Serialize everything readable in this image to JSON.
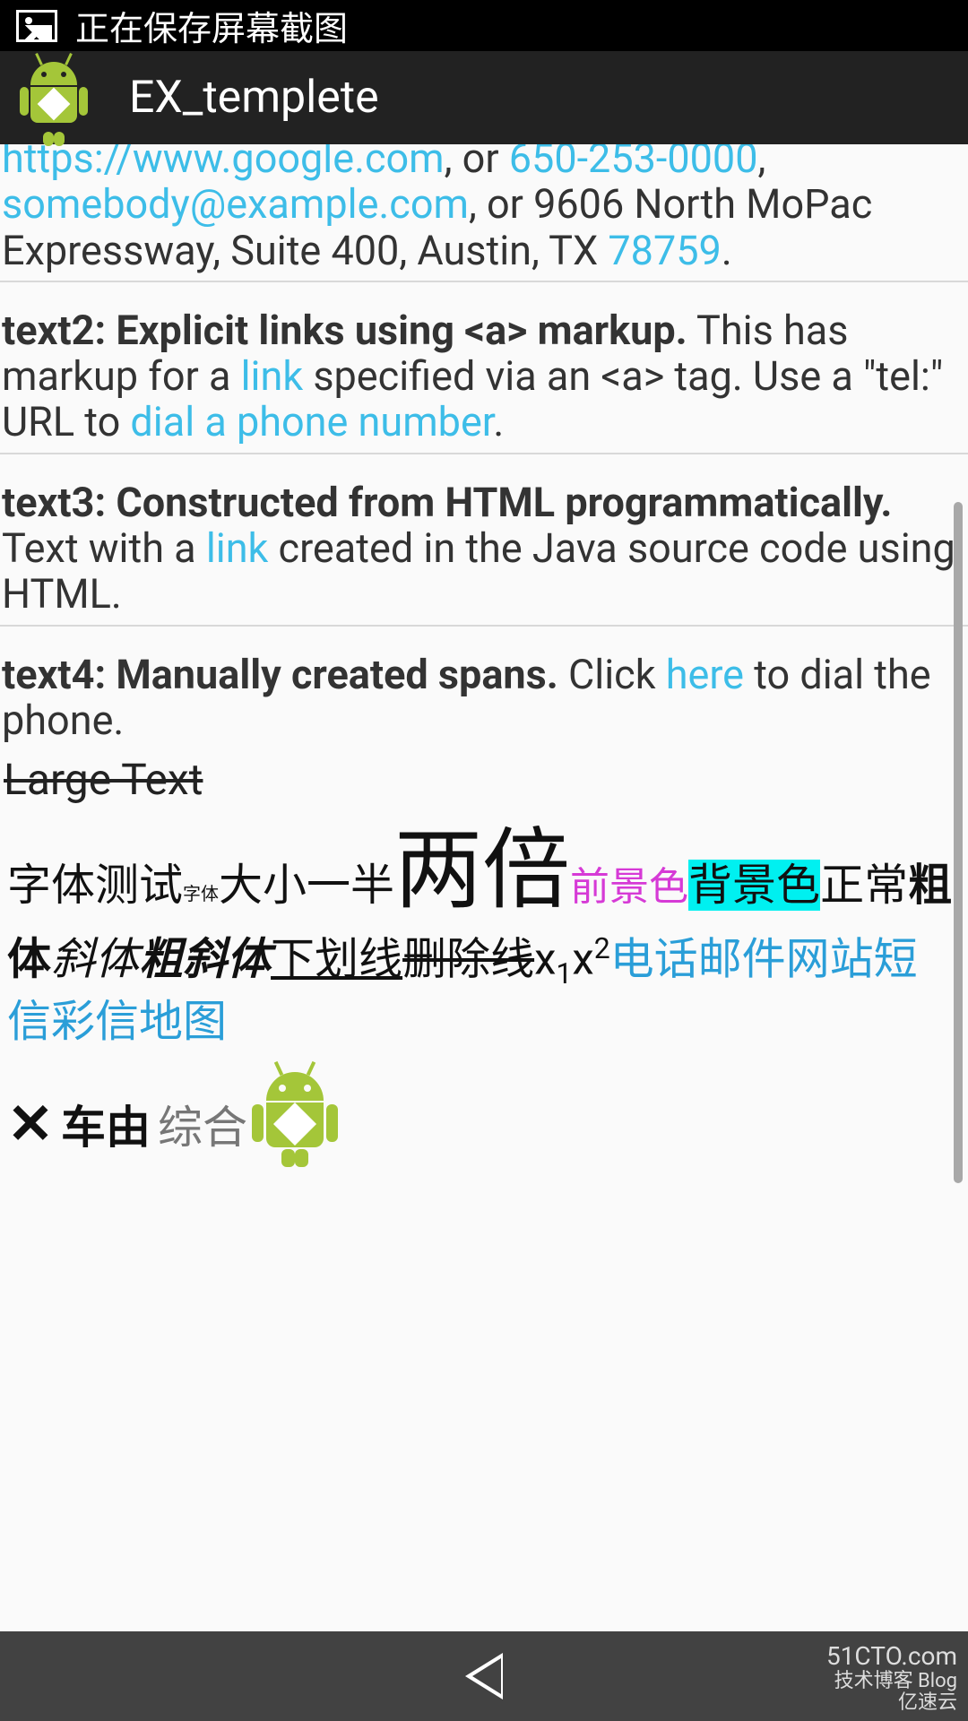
{
  "status_bar": {
    "saving_text": "正在保存屏幕截图"
  },
  "action_bar": {
    "title": "EX_templete"
  },
  "section1": {
    "url": "https://www.google.com",
    "sep1": ", or ",
    "phone": "650-253-0000",
    "sep2": ", ",
    "email": "somebody@example.com",
    "sep3": ", or 9606 North MoPac Expressway, Suite 400, Austin, TX ",
    "zip": "78759",
    "period": "."
  },
  "section2": {
    "bold": "text2: Explicit links using <a> markup.",
    "t1": " This has markup for a ",
    "link1": "link",
    "t2": " specified via an <a> tag. Use a \"tel:\" URL to ",
    "link2": "dial a phone number",
    "period": "."
  },
  "section3": {
    "bold": "text3: Constructed from HTML programmatically.",
    "t1": " Text with a ",
    "link1": "link",
    "t2": " created in the Java source code using HTML."
  },
  "section4": {
    "bold": "text4: Manually created spans.",
    "t1": " Click ",
    "link1": "here",
    "t2": " to dial the phone."
  },
  "large_text": "Large Text",
  "font_test": {
    "base": "字体测试",
    "tiny": "字体",
    "half": "大小一半",
    "double": "两倍",
    "fg": "前景色",
    "bg": "背景色",
    "normal": "正常",
    "bold": "粗体",
    "italic": "斜体",
    "bolditalic": "粗斜体",
    "underline": "下划线",
    "strike": "删除线",
    "sub_x": "x",
    "sub_1": "1",
    "sup_x": "x",
    "sup_2": "2",
    "links": "电话邮件网站短信彩信地图"
  },
  "mixed": {
    "bold_dark": "车由",
    "light": "综合"
  },
  "watermark": {
    "line1": "51CTO.com",
    "line2": "技术博客  Blog",
    "line3": "亿速云"
  }
}
